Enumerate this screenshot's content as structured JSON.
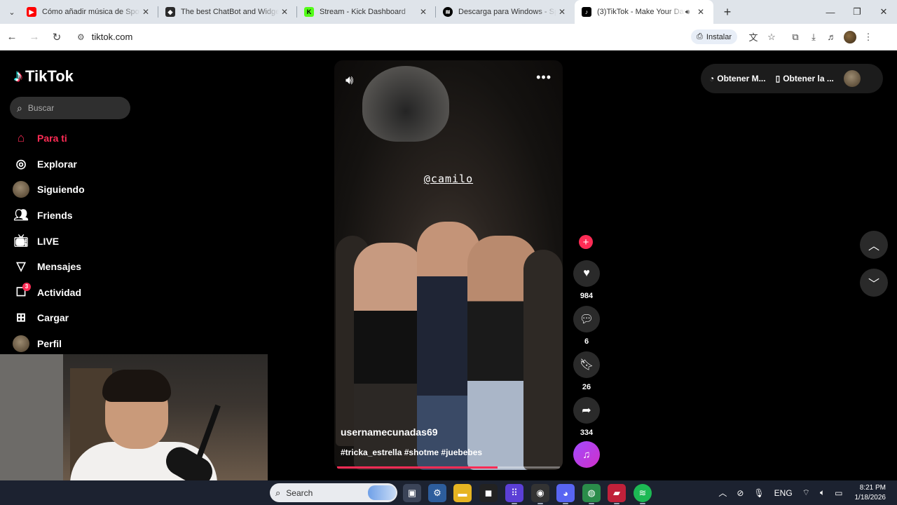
{
  "browser": {
    "tabs": [
      {
        "title": "Cómo añadir música de Spotify",
        "favicon_color": "#ff0000"
      },
      {
        "title": "The best ChatBot and Widgets f",
        "favicon_color": "#2b2b2b"
      },
      {
        "title": "Stream - Kick Dashboard",
        "favicon_color": "#53fc18"
      },
      {
        "title": "Descarga para Windows - Spoti",
        "favicon_color": "#1db954"
      },
      {
        "title": "(3)TikTok - Make Your Day",
        "favicon_color": "#000000"
      }
    ],
    "url": "tiktok.com",
    "install_label": "Instalar"
  },
  "tiktok": {
    "brand": "TikTok",
    "search_placeholder": "Buscar",
    "nav": [
      {
        "label": "Para ti",
        "icon": "home-icon"
      },
      {
        "label": "Explorar",
        "icon": "compass-icon"
      },
      {
        "label": "Siguiendo",
        "icon": "avatar"
      },
      {
        "label": "Friends",
        "icon": "friends-icon"
      },
      {
        "label": "LIVE",
        "icon": "live-icon"
      },
      {
        "label": "Mensajes",
        "icon": "send-icon"
      },
      {
        "label": "Actividad",
        "icon": "inbox-icon",
        "badge": "3"
      },
      {
        "label": "Cargar",
        "icon": "upload-icon"
      },
      {
        "label": "Perfil",
        "icon": "avatar"
      }
    ],
    "video": {
      "mention": "@camilo",
      "username": "usernamecunadas69",
      "hashtags": "#tricka_estrella #shotme #juebebes",
      "progress": 0.72
    },
    "actions": {
      "likes": "984",
      "comments": "6",
      "saves": "26",
      "shares": "334"
    },
    "topright": {
      "coins_label": "Obtener M...",
      "app_label": "Obtener la ..."
    },
    "accent": "#fe2c55"
  },
  "taskbar": {
    "search_label": "Search",
    "language": "ENG",
    "time": "8:21 PM",
    "date": "1/18/2026"
  }
}
